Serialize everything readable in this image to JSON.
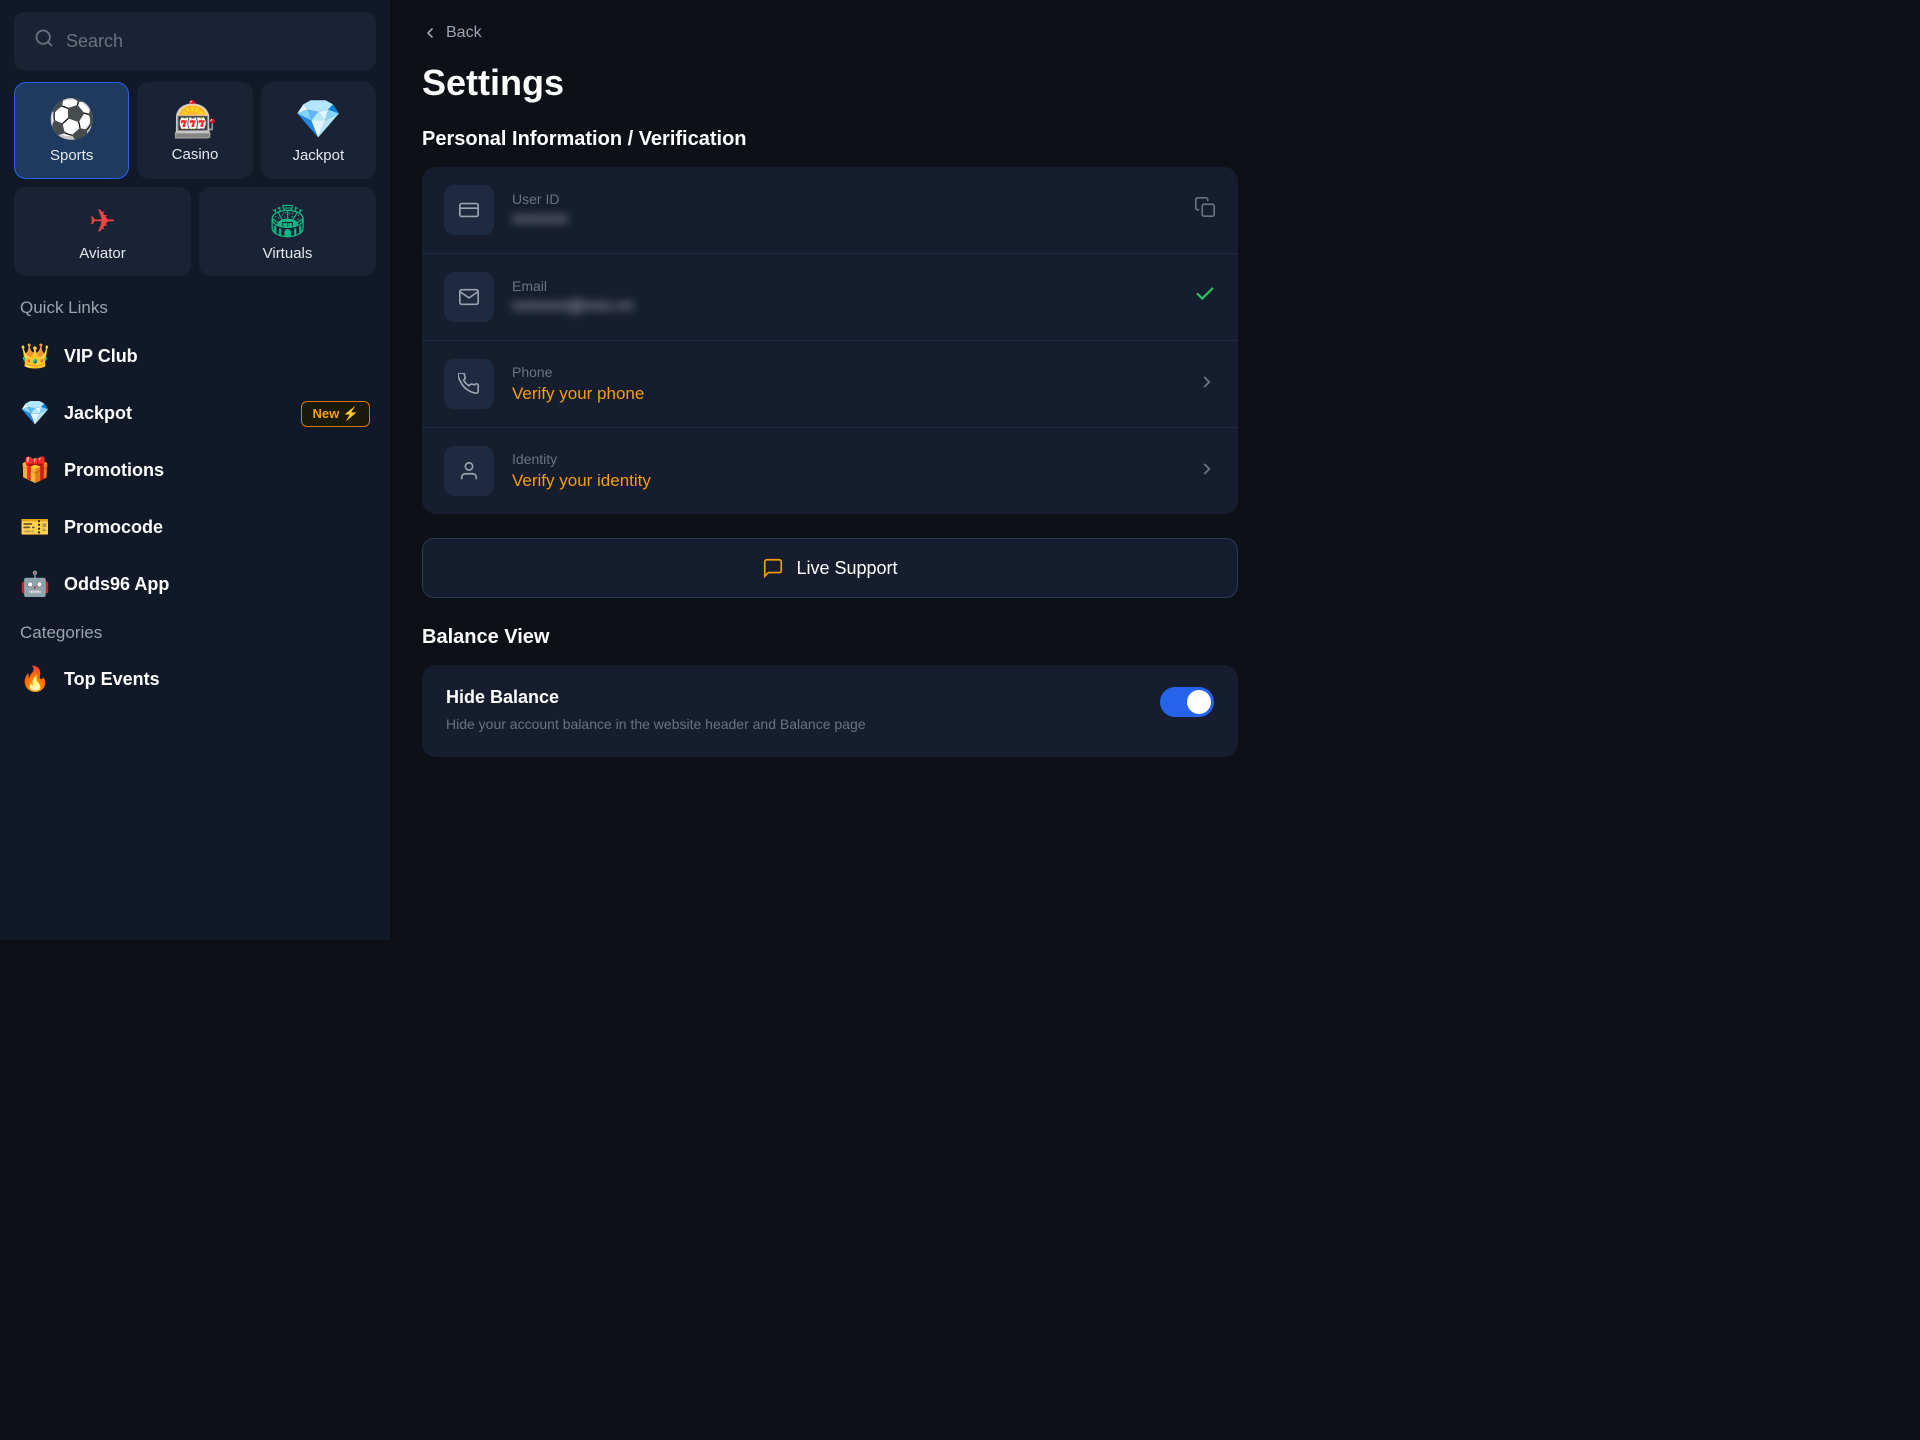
{
  "sidebar": {
    "search_placeholder": "Search",
    "nav_items": [
      {
        "id": "sports",
        "label": "Sports",
        "icon": "⚽",
        "active": true
      },
      {
        "id": "casino",
        "label": "Casino",
        "icon": "🎰",
        "active": false
      },
      {
        "id": "jackpot",
        "label": "Jackpot",
        "icon": "💎",
        "active": false
      }
    ],
    "nav_row2": [
      {
        "id": "aviator",
        "label": "Aviator",
        "icon": "✈️",
        "active": false
      },
      {
        "id": "virtuals",
        "label": "Virtuals",
        "icon": "🏟️",
        "active": false
      }
    ],
    "quick_links_title": "Quick Links",
    "quick_links": [
      {
        "id": "vip-club",
        "label": "VIP Club",
        "icon": "👑",
        "badge": null
      },
      {
        "id": "jackpot",
        "label": "Jackpot",
        "icon": "💎",
        "badge": "New ⚡"
      },
      {
        "id": "promotions",
        "label": "Promotions",
        "icon": "🎁",
        "badge": null
      },
      {
        "id": "promocode",
        "label": "Promocode",
        "icon": "🎫",
        "badge": null
      },
      {
        "id": "odds96-app",
        "label": "Odds96 App",
        "icon": "🤖",
        "badge": null
      }
    ],
    "categories_title": "Categories",
    "categories": [
      {
        "id": "top-events",
        "label": "Top Events",
        "icon": "🔥"
      }
    ]
  },
  "main": {
    "back_label": "Back",
    "page_title": "Settings",
    "personal_section_title": "Personal Information / Verification",
    "fields": [
      {
        "id": "user-id",
        "label": "User ID",
        "value": "••••••••••",
        "blurred": true,
        "icon": "card",
        "action": "copy"
      },
      {
        "id": "email",
        "label": "Email",
        "value": "••••••••••@•••••.•••",
        "blurred": true,
        "icon": "mail",
        "action": "check"
      },
      {
        "id": "phone",
        "label": "Phone",
        "value": "Verify your phone",
        "orange": true,
        "blurred": false,
        "icon": "phone",
        "action": "chevron"
      },
      {
        "id": "identity",
        "label": "Identity",
        "value": "Verify your identity",
        "orange": true,
        "blurred": false,
        "icon": "person",
        "action": "chevron"
      }
    ],
    "live_support_label": "Live Support",
    "balance_section_title": "Balance View",
    "hide_balance_label": "Hide Balance",
    "hide_balance_description": "Hide your account balance in the website header and Balance page",
    "hide_balance_on": true
  }
}
